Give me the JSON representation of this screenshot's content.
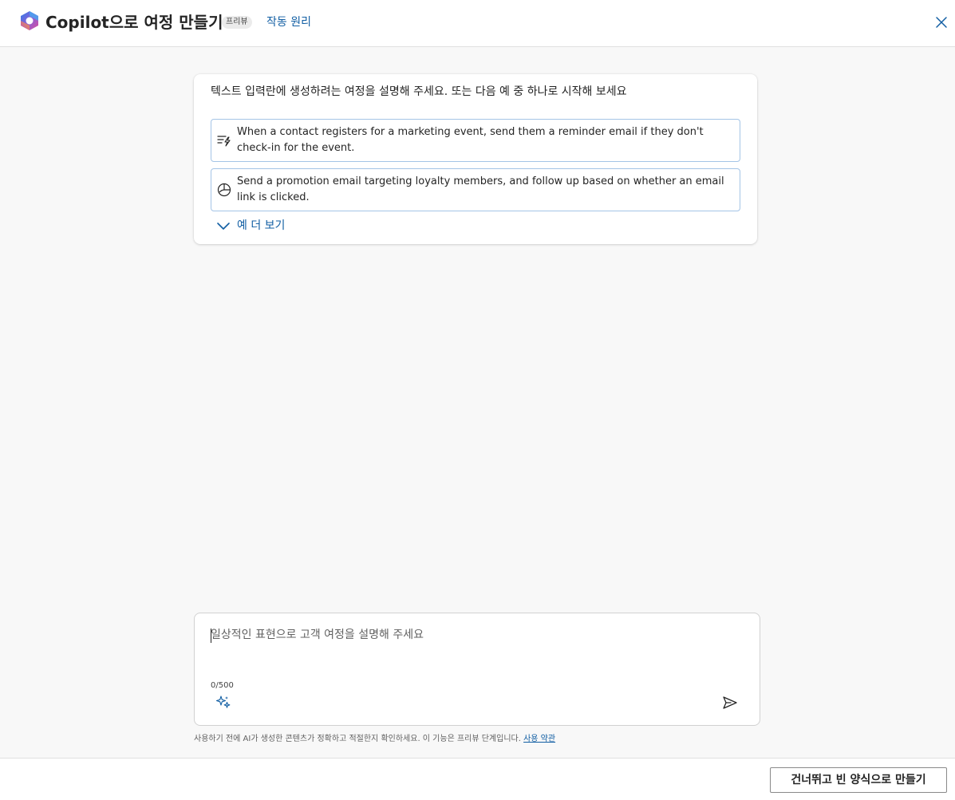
{
  "header": {
    "title": "Copilot으로 여정 만들기",
    "preview_badge": "프리뷰",
    "how_it_works_link": "작동 원리",
    "logo_icon": "copilot-logo-icon",
    "close_icon": "close-icon"
  },
  "suggestions_card": {
    "intro": "텍스트 입력란에 생성하려는 여정을 설명해 주세요. 또는 다음 예 중 하나로 시작해 보세요",
    "items": [
      {
        "icon": "event-trigger-icon",
        "text": "When a contact registers for a marketing event, send them a reminder email if they don't check-in for the event."
      },
      {
        "icon": "segment-icon",
        "text": "Send a promotion email targeting loyalty members, and follow up based on whether an email link is clicked."
      }
    ],
    "more_examples_label": "예 더 보기",
    "more_examples_icon": "chevron-down-icon"
  },
  "prompt": {
    "placeholder": "일상적인 표현으로 고객 여정을 설명해 주세요",
    "value": "",
    "char_count": "0/500",
    "sparkle_icon": "sparkle-icon",
    "send_icon": "send-icon"
  },
  "disclaimer": {
    "text": "사용하기 전에 AI가 생성한 콘텐츠가 정확하고 적절한지 확인하세요. 이 기능은 프리뷰 단계입니다. ",
    "terms_link": "사용 약관"
  },
  "footer": {
    "skip_button": "건너뛰고 빈 양식으로 만들기"
  },
  "colors": {
    "link": "#115ea3",
    "background": "#f8f8f8",
    "suggestion_border": "#a4c4e6"
  }
}
